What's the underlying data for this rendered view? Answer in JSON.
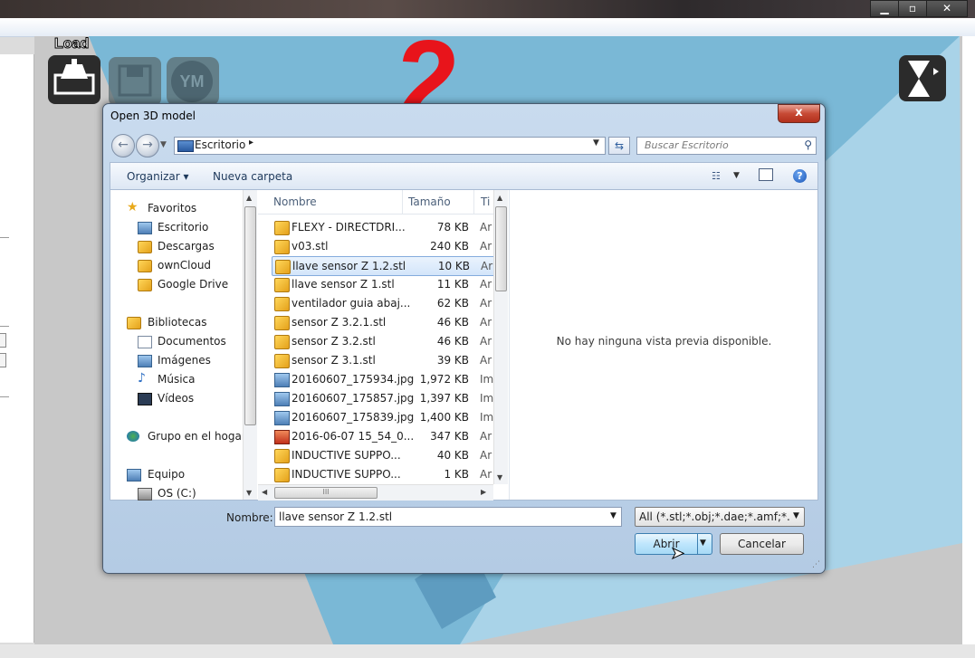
{
  "host": {
    "window_controls": {
      "minimize": "▁",
      "maximize": "▫",
      "close": "✕"
    },
    "load_label": "Load",
    "step_number": "2",
    "tools": [
      "load-tool-icon",
      "save-tool-icon",
      "ym-tool-icon",
      "right-tool-icon"
    ],
    "ym_text": "YM"
  },
  "dialog": {
    "title": "Open 3D model",
    "close": "x",
    "address": {
      "location": "Escritorio",
      "separator": "▸"
    },
    "search_placeholder": "Buscar Escritorio",
    "toolbar": {
      "organize": "Organizar ▾",
      "new_folder": "Nueva carpeta",
      "help": "?"
    },
    "nav": {
      "favorites_header": "Favoritos",
      "favorites": [
        "Escritorio",
        "Descargas",
        "ownCloud",
        "Google Drive"
      ],
      "libraries_header": "Bibliotecas",
      "libraries": [
        "Documentos",
        "Imágenes",
        "Música",
        "Vídeos"
      ],
      "homegroup": "Grupo en el hogar",
      "computer_header": "Equipo",
      "computer": [
        "OS (C:)"
      ]
    },
    "columns": {
      "name": "Nombre",
      "size": "Tamaño",
      "type": "Ti"
    },
    "files": [
      {
        "name": "FLEXY - DIRECTDRI...",
        "size": "78 KB",
        "type": "Ar",
        "icon": "box"
      },
      {
        "name": "v03.stl",
        "size": "240 KB",
        "type": "Ar",
        "icon": "box"
      },
      {
        "name": "llave sensor Z 1.2.stl",
        "size": "10 KB",
        "type": "Ar",
        "icon": "box"
      },
      {
        "name": "llave sensor Z 1.stl",
        "size": "11 KB",
        "type": "Ar",
        "icon": "box"
      },
      {
        "name": "ventilador guia abaj...",
        "size": "62 KB",
        "type": "Ar",
        "icon": "box"
      },
      {
        "name": "sensor Z 3.2.1.stl",
        "size": "46 KB",
        "type": "Ar",
        "icon": "box"
      },
      {
        "name": "sensor Z 3.2.stl",
        "size": "46 KB",
        "type": "Ar",
        "icon": "box"
      },
      {
        "name": "sensor Z 3.1.stl",
        "size": "39 KB",
        "type": "Ar",
        "icon": "box"
      },
      {
        "name": "20160607_175934.jpg",
        "size": "1,972 KB",
        "type": "Im",
        "icon": "img"
      },
      {
        "name": "20160607_175857.jpg",
        "size": "1,397 KB",
        "type": "Im",
        "icon": "img"
      },
      {
        "name": "20160607_175839.jpg",
        "size": "1,400 KB",
        "type": "Im",
        "icon": "img"
      },
      {
        "name": "2016-06-07 15_54_0...",
        "size": "347 KB",
        "type": "Ar",
        "icon": "pdf"
      },
      {
        "name": "INDUCTIVE SUPPO...",
        "size": "40 KB",
        "type": "Ar",
        "icon": "box"
      },
      {
        "name": "INDUCTIVE SUPPO...",
        "size": "1 KB",
        "type": "Ar",
        "icon": "box"
      }
    ],
    "selected_index": 2,
    "preview_text": "No hay ninguna vista previa disponible.",
    "filename_label": "Nombre:",
    "filename_value": "llave sensor Z 1.2.stl",
    "filter_value": "All (*.stl;*.obj;*.dae;*.amf;*.bmp",
    "open_label": "Abrir",
    "cancel_label": "Cancelar",
    "hscroll_grip": "III"
  },
  "colors": {
    "accent_red": "#e8141b",
    "viewport_blue": "#7ab8d6",
    "selection": "#d3e5fa"
  }
}
